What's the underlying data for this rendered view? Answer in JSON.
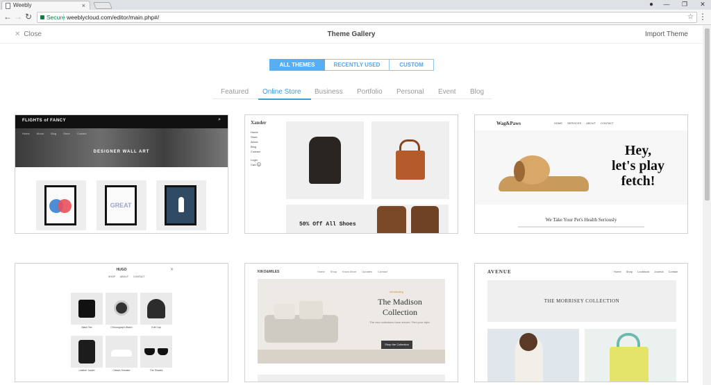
{
  "browser": {
    "tab_title": "Weebly",
    "tab_close": "×",
    "secure_label": "Secure",
    "url": "weeblycloud.com/editor/main.php#/",
    "window_controls": [
      "—",
      "❐",
      "✕"
    ]
  },
  "header": {
    "close_label": "Close",
    "title": "Theme Gallery",
    "import_label": "Import Theme"
  },
  "segments": [
    {
      "label": "ALL THEMES",
      "active": true
    },
    {
      "label": "RECENTLY USED",
      "active": false
    },
    {
      "label": "CUSTOM",
      "active": false
    }
  ],
  "categories": [
    {
      "label": "Featured",
      "active": false
    },
    {
      "label": "Online Store",
      "active": true
    },
    {
      "label": "Business",
      "active": false
    },
    {
      "label": "Portfolio",
      "active": false
    },
    {
      "label": "Personal",
      "active": false
    },
    {
      "label": "Event",
      "active": false
    },
    {
      "label": "Blog",
      "active": false
    }
  ],
  "themes": {
    "flights": {
      "logo": "FLIGHTS of FANCY",
      "nav": [
        "Home",
        "About",
        "Blog",
        "Store",
        "Contact"
      ],
      "hero_title": "DESIGNER WALL ART",
      "poster_text": "GREAT"
    },
    "xander": {
      "logo": "Xander",
      "nav": [
        "Home",
        "Store",
        "About",
        "Blog",
        "Contact"
      ],
      "login": "Login",
      "cart": "Cart",
      "cart_count": "0",
      "banner": "50% Off All Shoes"
    },
    "wag": {
      "logo": "Wag&Paws",
      "nav": [
        "HOME",
        "SERVICES",
        "ABOUT",
        "CONTACT"
      ],
      "headline_1": "Hey,",
      "headline_2": "let's play",
      "headline_3": "fetch!",
      "caption": "We Take Your Pet's Health Seriously"
    },
    "hugo": {
      "logo": "HUGO",
      "nav": [
        "SHOP",
        "ABOUT",
        "CONTACT"
      ],
      "products": [
        "Black Tee",
        "Chronograph Watch",
        "Knit Cap",
        "Leather Jacket",
        "Classic Sneaker",
        "The Shades"
      ]
    },
    "kiko": {
      "logo": "KIKO&MILES",
      "nav": [
        "Home",
        "Shop",
        "Know More",
        "Updates",
        "Contact"
      ],
      "subtitle": "Introducing",
      "title": "The Madison Collection",
      "desc": "The new collections have arrived. Find your style.",
      "button": "Shop the Collection"
    },
    "avenue": {
      "logo": "AVENUE",
      "nav": [
        "Home",
        "Shop",
        "Lookbook",
        "Journal",
        "Contact"
      ],
      "band": "THE MORRISEY COLLECTION"
    }
  }
}
